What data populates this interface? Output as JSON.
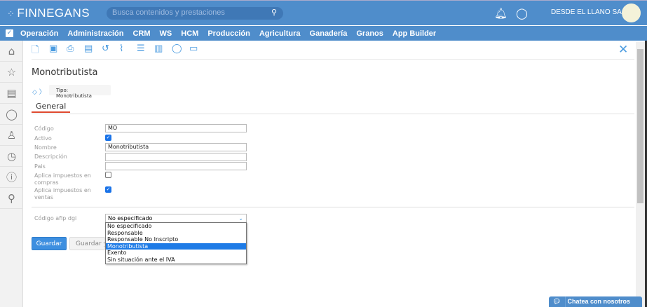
{
  "header": {
    "logo": "FINNEGANS",
    "search_placeholder": "Busca contenidos y prestaciones",
    "company": "DESDE EL LLANO SAS"
  },
  "menu": [
    "Operación",
    "Administración",
    "CRM",
    "WS",
    "HCM",
    "Producción",
    "Agricultura",
    "Ganadería",
    "Granos",
    "App Builder"
  ],
  "page": {
    "title": "Monotributista",
    "breadcrumb": "Tipo: Monotributista",
    "tab": "General"
  },
  "form": {
    "codigo_label": "Código",
    "codigo_value": "MO",
    "activo_label": "Activo",
    "activo_checked": true,
    "nombre_label": "Nombre",
    "nombre_value": "Monotributista",
    "descripcion_label": "Descripción",
    "descripcion_value": "",
    "pais_label": "Pais",
    "pais_value": "",
    "compras_label1": "Aplica impuestos en",
    "compras_label2": "compras",
    "compras_checked": false,
    "ventas_label1": "Aplica impuestos en",
    "ventas_label2": "ventas",
    "ventas_checked": true,
    "afip_label": "Código afip dgi",
    "afip_value": "No especificado",
    "afip_options": [
      "No especificado",
      "Responsable",
      "Responsable No Inscripto",
      "Monotributista",
      "Exento",
      "Sin situación ante el IVA"
    ],
    "afip_highlighted": "Monotributista"
  },
  "buttons": {
    "save": "Guardar",
    "save_and": "Guardar y nuevo"
  },
  "chat": {
    "label": "Chatea con nosotros"
  },
  "colors": {
    "brand": "#4f8dcb",
    "accent": "#e04a2f",
    "selection": "#1e7be6"
  }
}
